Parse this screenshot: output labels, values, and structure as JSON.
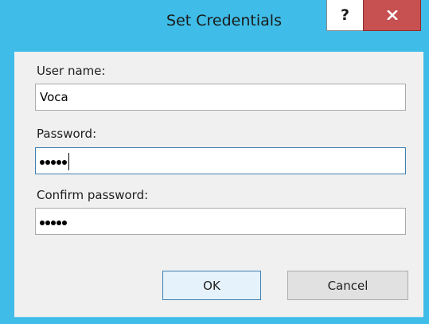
{
  "window": {
    "title": "Set Credentials",
    "help_label": "?",
    "close_icon": "close-icon",
    "colors": {
      "frame": "#3fbde8",
      "close_button": "#c75050",
      "client": "#f0f0f0",
      "focus_border": "#3c7fb1"
    }
  },
  "form": {
    "username": {
      "label": "User name:",
      "value": "Voca"
    },
    "password": {
      "label": "Password:",
      "masked_length": 5
    },
    "confirm": {
      "label": "Confirm password:",
      "masked_length": 5
    }
  },
  "buttons": {
    "ok_label": "OK",
    "cancel_label": "Cancel"
  }
}
